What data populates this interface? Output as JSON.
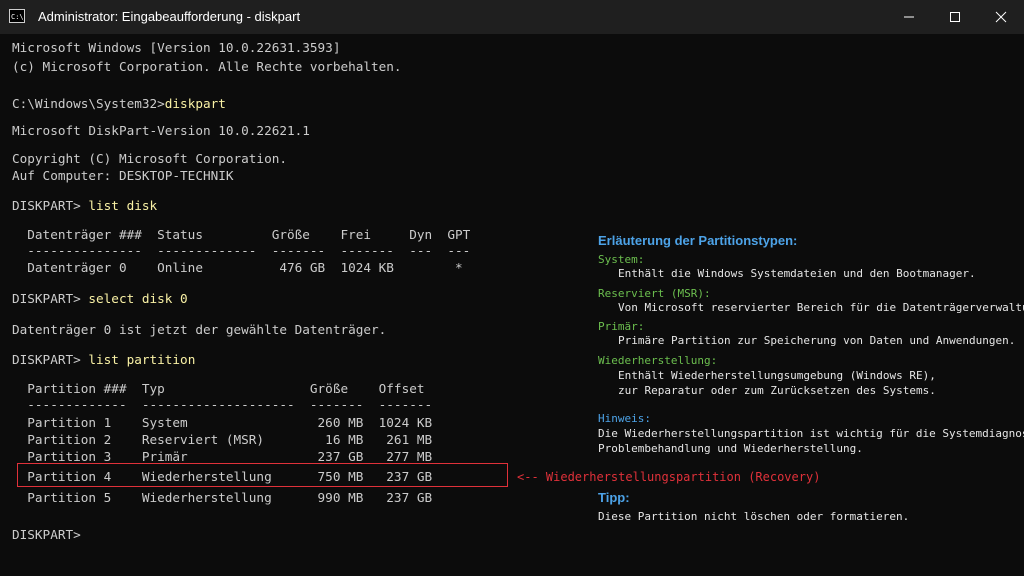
{
  "window": {
    "title": "Administrator: Eingabeaufforderung - diskpart",
    "icon_text": "C:\\_"
  },
  "console": {
    "line1": "Microsoft Windows [Version 10.0.22631.3593]",
    "line2": "(c) Microsoft Corporation. Alle Rechte vorbehalten.",
    "prompt1": "C:\\Windows\\System32>",
    "cmd1": "diskpart",
    "version_line": "Microsoft DiskPart-Version 10.0.22621.1",
    "copyright_line": "Copyright (C) Microsoft Corporation.",
    "computer_line": "Auf Computer: DESKTOP-TECHNIK",
    "prompt": "DISKPART> ",
    "cmd_list_disk": "list disk",
    "disk_header": "  Datenträger ###  Status         Größe    Frei     Dyn  GPT",
    "disk_sep": "  ---------------  -------------  -------  -------  ---  ---",
    "disk_row": "  Datenträger 0    Online          476 GB  1024 KB        *",
    "cmd_select": "select disk 0",
    "select_result": "Datenträger 0 ist jetzt der gewählte Datenträger.",
    "cmd_list_partition": "list partition",
    "part_header": "  Partition ###  Typ                   Größe    Offset",
    "part_sep": "  -------------  --------------------  -------  -------",
    "part_rows": [
      "  Partition 1    System                 260 MB  1024 KB",
      "  Partition 2    Reserviert (MSR)        16 MB   261 MB",
      "  Partition 3    Primär                 237 GB   277 MB",
      "  Partition 4    Wiederherstellung      750 MB   237 GB",
      "  Partition 5    Wiederherstellung      990 MB   237 GB"
    ],
    "final_prompt": "DISKPART>"
  },
  "annotation": {
    "label": "<-- Wiederherstellungspartition (Recovery)",
    "color": "#e0313a"
  },
  "panel": {
    "title": "Erläuterung der Partitionstypen:",
    "entries": [
      {
        "head": "System:",
        "lines": [
          "Enthält die Windows Systemdateien und den Bootmanager."
        ]
      },
      {
        "head": "Reserviert (MSR):",
        "lines": [
          "Von Microsoft reservierter Bereich für die Datenträgerverwaltung."
        ]
      },
      {
        "head": "Primär:",
        "lines": [
          "Primäre Partition zur Speicherung von Daten und Anwendungen."
        ]
      },
      {
        "head": "Wiederherstellung:",
        "lines": [
          "Enthält Wiederherstellungsumgebung (Windows RE),",
          "zur Reparatur oder zum Zurücksetzen des Systems."
        ]
      }
    ],
    "hint_head": "Hinweis:",
    "hint_lines": [
      "Die Wiederherstellungspartition ist wichtig für die Systemdiagnose,",
      "Problembehandlung und Wiederherstellung."
    ],
    "tip_head": "Tipp:",
    "tip_line": "Diese Partition nicht löschen oder formatieren."
  },
  "colors": {
    "background": "#0c0c0c",
    "text": "#cccccc",
    "command": "#f9f1a5",
    "panel_title": "#4da3e8",
    "panel_head": "#6cbf4f"
  }
}
